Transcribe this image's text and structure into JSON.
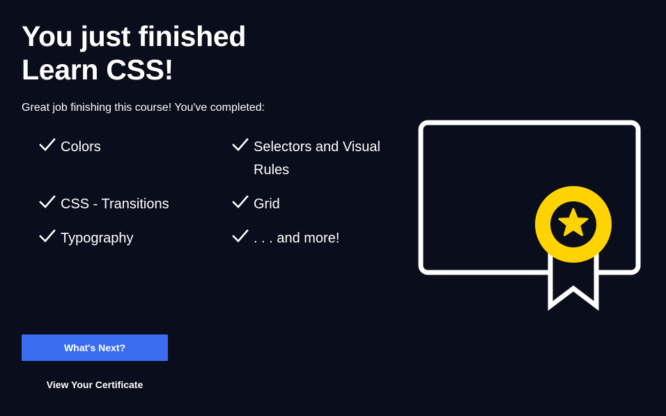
{
  "header": {
    "title_line1": "You just finished",
    "title_line2": "Learn CSS!"
  },
  "subtitle": "Great job finishing this course! You've completed:",
  "topics": [
    {
      "label": "Colors",
      "icon": "check-icon"
    },
    {
      "label": "Selectors and Visual Rules",
      "icon": "check-icon"
    },
    {
      "label": "CSS - Transitions",
      "icon": "check-icon"
    },
    {
      "label": "Grid",
      "icon": "check-icon"
    },
    {
      "label": "Typography",
      "icon": "check-icon"
    },
    {
      "label": ". . . and more!",
      "icon": "check-icon"
    }
  ],
  "certificate": {
    "icon": "certificate-icon",
    "badge_icon": "star-badge-icon",
    "colors": {
      "outline": "#ffffff",
      "badge": "#ffd300",
      "star": "#0a0d1c"
    }
  },
  "actions": {
    "next_label": "What's Next?",
    "certificate_label": "View Your Certificate"
  },
  "colors": {
    "background": "#0a0d1c",
    "text": "#ffffff",
    "primary_button": "#3a6df0"
  }
}
